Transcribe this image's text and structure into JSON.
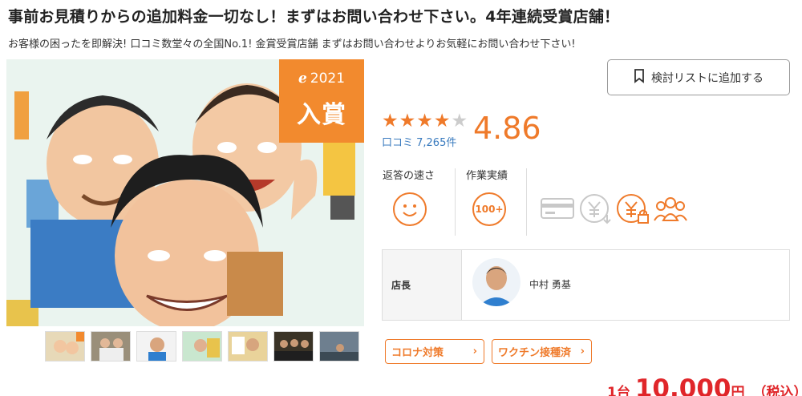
{
  "header": {
    "title": "事前お見積りからの追加料金一切なし！まずはお問い合わせ下さい。4年連続受賞店舗！",
    "subtitle": "お客様の困ったを即解決! 口コミ数堂々の全国No.1! 金賞受賞店舗 まずはお問い合わせよりお気軽にお問い合わせ下さい!"
  },
  "award": {
    "year": "2021",
    "label": "入賞"
  },
  "bookmark": {
    "label": "検討リストに追加する",
    "icon": "bookmark-icon"
  },
  "rating": {
    "stars": 4.86,
    "stars_display": [
      "★",
      "★",
      "★",
      "★",
      "★"
    ],
    "reviews_label": "口コミ 7,265件",
    "score": "4.86",
    "colors": {
      "star_filled": "#ef7a2a",
      "star_empty": "#cccccc"
    }
  },
  "metrics": {
    "response_label": "返答の速さ",
    "work_label": "作業実績",
    "work_badge": "100+"
  },
  "payment_icons": [
    "credit-card-icon",
    "yen-refund-icon",
    "yen-lock-icon",
    "group-icon"
  ],
  "manager": {
    "role": "店長",
    "name": "中村 勇基"
  },
  "tags": [
    {
      "label": "コロナ対策",
      "arrow": "›"
    },
    {
      "label": "ワクチン接種済",
      "arrow": "›"
    }
  ],
  "price": {
    "unit": "1台",
    "amount": "10,000",
    "yen": "円",
    "tax": "（税込）"
  },
  "colors": {
    "accent": "#ef7a2a",
    "price": "#e0262a",
    "link": "#3a7bbf"
  }
}
